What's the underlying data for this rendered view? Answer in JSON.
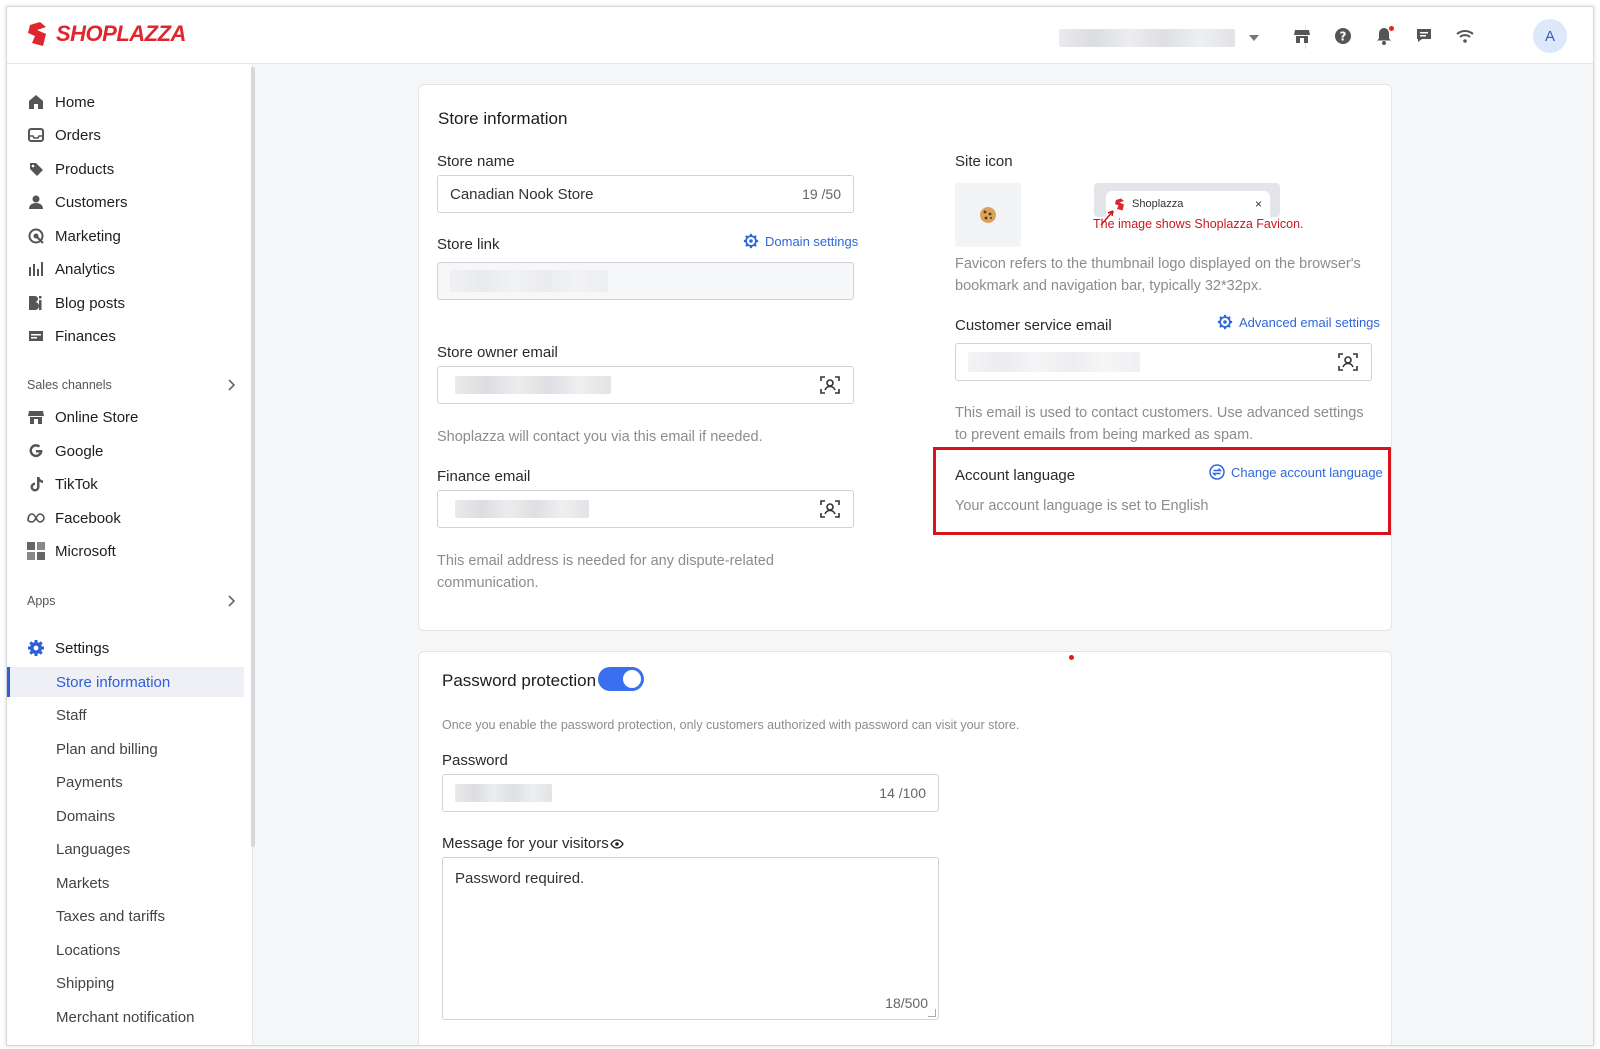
{
  "brand": {
    "name": "SHOPLAZZA",
    "color": "#e0262d"
  },
  "topbar": {
    "icons": [
      "online-store-icon",
      "help-icon",
      "notification-icon",
      "chat-icon",
      "wifi-icon"
    ],
    "avatar_initial": "A"
  },
  "sidebar": {
    "main": [
      {
        "label": "Home",
        "icon": "home-icon"
      },
      {
        "label": "Orders",
        "icon": "orders-icon"
      },
      {
        "label": "Products",
        "icon": "products-icon"
      },
      {
        "label": "Customers",
        "icon": "customers-icon"
      },
      {
        "label": "Marketing",
        "icon": "marketing-icon"
      },
      {
        "label": "Analytics",
        "icon": "analytics-icon"
      },
      {
        "label": "Blog posts",
        "icon": "blog-icon"
      },
      {
        "label": "Finances",
        "icon": "finances-icon"
      }
    ],
    "sales_channels_label": "Sales channels",
    "channels": [
      {
        "label": "Online Store",
        "icon": "online-store-icon"
      },
      {
        "label": "Google",
        "icon": "google-icon"
      },
      {
        "label": "TikTok",
        "icon": "tiktok-icon"
      },
      {
        "label": "Facebook",
        "icon": "meta-icon"
      },
      {
        "label": "Microsoft",
        "icon": "microsoft-icon"
      }
    ],
    "apps_label": "Apps",
    "settings_label": "Settings",
    "settings_items": [
      {
        "label": "Store information",
        "active": true
      },
      {
        "label": "Staff"
      },
      {
        "label": "Plan and billing"
      },
      {
        "label": "Payments"
      },
      {
        "label": "Domains"
      },
      {
        "label": "Languages"
      },
      {
        "label": "Markets"
      },
      {
        "label": "Taxes and tariffs"
      },
      {
        "label": "Locations"
      },
      {
        "label": "Shipping"
      },
      {
        "label": "Merchant notification"
      }
    ]
  },
  "store_info": {
    "title": "Store information",
    "store_name_label": "Store name",
    "store_name_value": "Canadian Nook Store",
    "store_name_count": "19 /50",
    "store_link_label": "Store link",
    "domain_settings_link": "Domain settings",
    "owner_email_label": "Store owner email",
    "owner_email_help": "Shoplazza will contact you via this email if needed.",
    "finance_email_label": "Finance email",
    "finance_email_help": "This email address is needed for any dispute-related communication.",
    "site_icon_label": "Site icon",
    "favicon_tab_title": "Shoplazza",
    "favicon_tab_close": "×",
    "favicon_annotation": "The image shows Shoplazza Favicon.",
    "favicon_help": "Favicon refers to the thumbnail logo displayed on the browser's bookmark and navigation bar, typically 32*32px.",
    "cs_email_label": "Customer service email",
    "advanced_email_link": "Advanced email settings",
    "cs_email_help": "This email is used to contact customers. Use advanced settings to prevent emails from being marked as spam.",
    "account_language_label": "Account language",
    "change_language_link": "Change account language",
    "account_language_text": "Your account language is set to English"
  },
  "password": {
    "title": "Password protection",
    "enabled": true,
    "help": "Once you enable the password protection, only customers authorized with password can visit your store.",
    "password_label": "Password",
    "password_count": "14 /100",
    "message_label": "Message for your visitors",
    "message_value": "Password required.",
    "message_count": "18/500"
  },
  "colors": {
    "accent": "#2e5ed8",
    "link": "#2e68d8",
    "highlight": "#d7141b",
    "toggle": "#3a6ff0"
  }
}
